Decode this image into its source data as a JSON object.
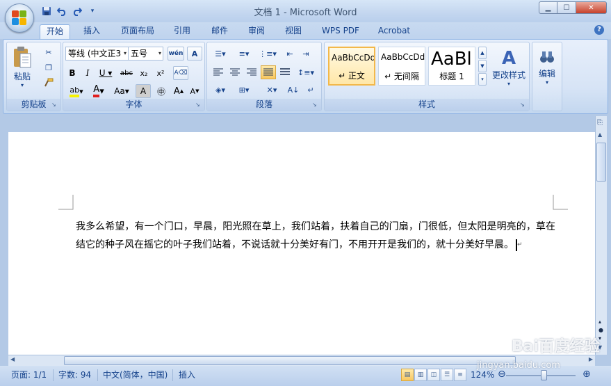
{
  "window": {
    "title": "文档 1 - Microsoft Word"
  },
  "qat": {
    "icons": [
      "save-icon",
      "undo-icon",
      "redo-icon",
      "customize-icon"
    ]
  },
  "tabs": [
    {
      "label": "开始",
      "active": true
    },
    {
      "label": "插入"
    },
    {
      "label": "页面布局"
    },
    {
      "label": "引用"
    },
    {
      "label": "邮件"
    },
    {
      "label": "审阅"
    },
    {
      "label": "视图"
    },
    {
      "label": "WPS PDF"
    },
    {
      "label": "Acrobat"
    }
  ],
  "ribbon": {
    "clipboard": {
      "paste_label": "粘贴",
      "group_label": "剪贴板"
    },
    "font": {
      "font_name": "等线 (中文正3",
      "font_size": "五号",
      "group_label": "字体"
    },
    "paragraph": {
      "group_label": "段落"
    },
    "styles": {
      "group_label": "样式",
      "items": [
        {
          "sample": "AaBbCcDd",
          "name": "↵ 正文"
        },
        {
          "sample": "AaBbCcDd",
          "name": "↵ 无间隔"
        },
        {
          "sample": "AaBl",
          "name": "标题 1"
        }
      ],
      "change_label": "更改样式"
    },
    "editing": {
      "label": "编辑"
    }
  },
  "document": {
    "text": "我多么希望，有一个门口，早晨，阳光照在草上，我们站着，扶着自己的门扇，门很低，但太阳是明亮的，草在结它的种子风在摇它的叶子我们站着，不说话就十分美好有门，不用开开是我们的，就十分美好早晨。"
  },
  "status": {
    "page": "页面: 1/1",
    "words": "字数: 94",
    "language": "中文(简体，中国)",
    "mode": "插入",
    "zoom": "124%"
  },
  "watermark": {
    "brand": "Bai百度经验",
    "url": "jingyan.baidu.com"
  },
  "colors": {
    "accent": "#15428b",
    "ribbon_bg": "#d7e4f6",
    "active_style": "#ffe7a8"
  }
}
